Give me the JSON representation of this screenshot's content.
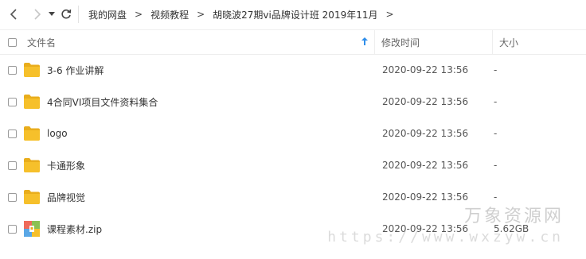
{
  "breadcrumb": [
    "我的网盘",
    "视频教程",
    "胡晓波27期vi品牌设计班 2019年11月"
  ],
  "columns": {
    "name": "文件名",
    "modified": "修改时间",
    "size": "大小"
  },
  "files": [
    {
      "name": "3-6 作业讲解",
      "modified": "2020-09-22 13:56",
      "size": "-",
      "icon": "folder-icon"
    },
    {
      "name": "4合同VI项目文件资料集合",
      "modified": "2020-09-22 13:56",
      "size": "-",
      "icon": "folder-icon"
    },
    {
      "name": "logo",
      "modified": "2020-09-22 13:56",
      "size": "-",
      "icon": "folder-icon"
    },
    {
      "name": "卡通形象",
      "modified": "2020-09-22 13:56",
      "size": "-",
      "icon": "folder-icon"
    },
    {
      "name": "品牌视觉",
      "modified": "2020-09-22 13:56",
      "size": "-",
      "icon": "folder-icon"
    },
    {
      "name": "课程素材.zip",
      "modified": "2020-09-22 13:56",
      "size": "5.62GB",
      "icon": "zip-archive-icon"
    }
  ],
  "watermark": {
    "title": "万象资源网",
    "url": "https://www.wxzyw.cn"
  },
  "colors": {
    "folder": "#f6c02b",
    "folder_dark": "#e9ad1c",
    "sort_accent": "#2f8eea"
  }
}
